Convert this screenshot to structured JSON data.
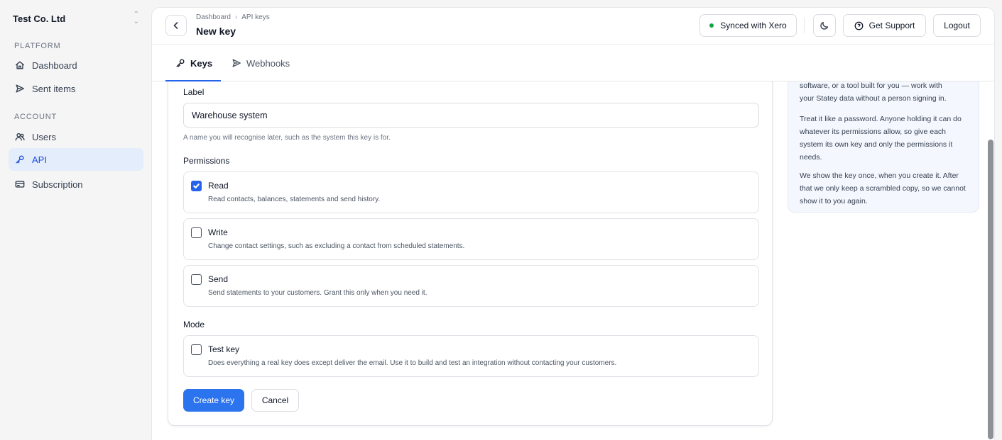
{
  "sidebar": {
    "org_name": "Test Co. Ltd",
    "sections": {
      "platform": "PLATFORM",
      "account": "ACCOUNT"
    },
    "items": [
      {
        "label": "Dashboard",
        "icon": "home-icon"
      },
      {
        "label": "Sent items",
        "icon": "send-icon"
      },
      {
        "label": "Users",
        "icon": "users-icon"
      },
      {
        "label": "API",
        "icon": "key-icon",
        "active": true
      },
      {
        "label": "Subscription",
        "icon": "credit-card-icon"
      }
    ]
  },
  "header": {
    "breadcrumbs": [
      "Dashboard",
      "API keys"
    ],
    "title": "New key",
    "sync_label": "Synced with Xero",
    "support_label": "Get Support",
    "logout_label": "Logout"
  },
  "tabs": [
    {
      "label": "Keys",
      "icon": "key-icon",
      "active": true
    },
    {
      "label": "Webhooks",
      "icon": "send-icon"
    }
  ],
  "form": {
    "label_heading": "Label",
    "label_value": "Warehouse system",
    "label_helper": "A name you will recognise later, such as the system this key is for.",
    "permissions_heading": "Permissions",
    "permissions": [
      {
        "title": "Read",
        "description": "Read contacts, balances, statements and send history.",
        "checked": true
      },
      {
        "title": "Write",
        "description": "Change contact settings, such as excluding a contact from scheduled statements.",
        "checked": false
      },
      {
        "title": "Send",
        "description": "Send statements to your customers. Grant this only when you need it.",
        "checked": false
      }
    ],
    "mode_heading": "Mode",
    "mode": {
      "title": "Test key",
      "description": "Does everything a real key does except deliver the email. Use it to build and test an integration without contacting your customers.",
      "checked": false
    },
    "create_label": "Create key",
    "cancel_label": "Cancel"
  },
  "info": {
    "line_partial": "software, or a tool built for you — work with",
    "line_end": "your Statey data without a person signing in.",
    "p2": "Treat it like a password. Anyone holding it can do whatever its permissions allow, so give each system its own key and only the permissions it needs.",
    "p3": "We show the key once, when you create it. After that we only keep a scrambled copy, so we cannot show it to you again."
  },
  "colors": {
    "accent": "#2b74ee",
    "active_nav_bg": "#e4edfb",
    "sync_dot": "#16a34a",
    "info_bg": "#f4f7fd"
  }
}
